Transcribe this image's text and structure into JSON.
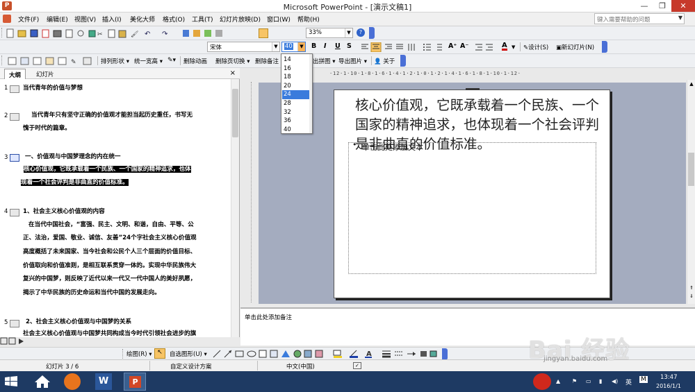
{
  "app": {
    "title": "Microsoft PowerPoint - [演示文稿1]",
    "icon": "P"
  },
  "window_controls": {
    "min": "—",
    "max": "❐",
    "close": "✕"
  },
  "menu": {
    "items": [
      "文件(F)",
      "编辑(E)",
      "视图(V)",
      "插入(I)",
      "美化大师",
      "格式(O)",
      "工具(T)",
      "幻灯片放映(D)",
      "窗口(W)",
      "帮助(H)"
    ],
    "help_placeholder": "键入需要帮助的问题"
  },
  "toolbar_standard": {
    "zoom": "33%"
  },
  "toolbar_format": {
    "font_name": "宋体",
    "font_size": "40",
    "bold": "B",
    "italic": "I",
    "underline": "U",
    "shadow": "S",
    "grow": "A⁺",
    "shrink": "A⁻",
    "design_label": "设计(S)",
    "new_slide_label": "新幻灯片(N)"
  },
  "toolbar_misc": {
    "items": [
      "排列形状",
      "统一宽高",
      "删除动画",
      "删除页切换",
      "删除备注",
      "出拼图",
      "导出图片",
      "关于"
    ]
  },
  "font_size_options": [
    "14",
    "16",
    "18",
    "20",
    "24",
    "28",
    "32",
    "36",
    "40"
  ],
  "font_size_highlight": "24",
  "left_pane": {
    "tabs": [
      "大纲",
      "幻灯片"
    ],
    "close": "×",
    "slides": [
      {
        "num": "1",
        "lines": [
          "当代青年的价值与梦想"
        ]
      },
      {
        "num": "2",
        "lines": [
          "当代青年只有坚守正确的价值观才能担当起历史重任，书写无",
          "愧于时代的篇章。"
        ]
      },
      {
        "num": "3",
        "lines": [
          "一、价值观与中国梦理念的内在统一",
          "核心价值观，它既承载着一个民族、一个国家的精神追求，也体",
          "现着一个社会评判是非曲直的价值标准。"
        ]
      },
      {
        "num": "4",
        "lines": [
          "1、社会主义核心价值观的内容",
          "在当代中国社会，“富强、民主、文明、和谐，自由、平等、公",
          "正、法治，爱国、敬业、诚信、友善”24个字社会主义核心价值观",
          "高度概括了未来国家、当今社会和公民个人三个层面的价值目标、",
          "价值取向和价值准则，是相互联系贯穿一体的。实现中华民族伟大",
          "复兴的中国梦，则反映了近代以来一代又一代中国人的美好夙愿，",
          "揭示了中华民族的历史命运和当代中国的发展走向。"
        ]
      },
      {
        "num": "5",
        "lines": [
          "2、社会主义核心价值观与中国梦的关系",
          "社会主义核心价值观与中国梦共同构成当今时代引领社会进步的旗"
        ]
      }
    ]
  },
  "slide": {
    "text": "核心价值观，它既承载着一个民族、一个国家的精神追求，也体现着一个社会评判是非曲直的价值标准。",
    "bullet": "•",
    "placeholder": "单击此处添加文本"
  },
  "ruler_h": "·12·1·10·1·8·1·6·1·4·1·2·1·0·1·2·1·4·1·6·1·8·1·10·1·12·",
  "notes": {
    "placeholder": "单击此处添加备注"
  },
  "draw_toolbar": {
    "draw": "绘图(R)",
    "autoshape": "自选图形(U)"
  },
  "status": {
    "slide_pos": "幻灯片 3 / 6",
    "design": "自定义设计方案",
    "language": "中文(中国)"
  },
  "taskbar": {
    "time": "13:47",
    "date": "2016/1/1",
    "ime": "英",
    "ime2": "M"
  },
  "watermark": {
    "text": "Bai 经验",
    "url": "jingyan.baidu.com"
  }
}
